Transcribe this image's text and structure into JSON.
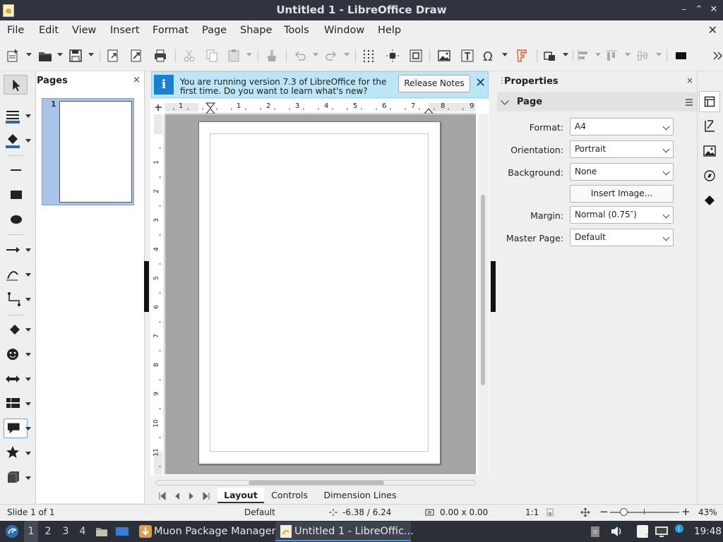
{
  "window": {
    "title": "Untitled 1 - LibreOffice Draw",
    "minimize_glyph": "–",
    "maximize_glyph": "⌃",
    "restore_glyph": "✕"
  },
  "menubar": {
    "items": [
      "File",
      "Edit",
      "View",
      "Insert",
      "Format",
      "Page",
      "Shape",
      "Tools",
      "Window",
      "Help"
    ],
    "close_glyph": "✕"
  },
  "toolbar": {
    "icons": [
      "new-icon",
      "open-icon",
      "save-icon",
      "export-icon",
      "export-pdf-icon",
      "print-icon",
      "cut-icon",
      "copy-icon",
      "paste-icon",
      "clone-formatting-icon",
      "undo-icon",
      "redo-icon",
      "grid-icon",
      "helplines-icon",
      "zoom-pan-icon",
      "image-icon",
      "textbox-icon",
      "special-character-icon",
      "fontwork-icon",
      "transformations-icon",
      "align-icon",
      "arrange-icon",
      "distribute-icon",
      "shadow-icon",
      "more-icon"
    ]
  },
  "left_toolbar": {
    "icons": [
      "select-icon",
      "line-color-icon",
      "fill-color-icon",
      "line-icon",
      "rectangle-icon",
      "ellipse-icon",
      "arrow-line-icon",
      "curve-icon",
      "connector-icon",
      "basic-shapes-icon",
      "symbol-shapes-icon",
      "block-arrows-icon",
      "flowchart-icon",
      "callouts-icon",
      "stars-icon",
      "3d-objects-icon"
    ]
  },
  "pages_panel": {
    "title": "Pages",
    "close_glyph": "×",
    "thumbnail_number": "1"
  },
  "infobar": {
    "message": "You are running version 7.3 of LibreOffice for the first time. Do you want to learn what's new?",
    "button": "Release Notes",
    "close_glyph": "✕",
    "icon_glyph": "i"
  },
  "ruler": {
    "h_labels": [
      "1",
      "1",
      "1",
      "2",
      "3",
      "4",
      "5",
      "6",
      "7",
      "8",
      "9"
    ],
    "v_labels": [
      "1",
      "1",
      "2",
      "3",
      "4",
      "5",
      "6",
      "7",
      "8",
      "9",
      "10",
      "11"
    ]
  },
  "tabs": {
    "items": [
      "Layout",
      "Controls",
      "Dimension Lines"
    ],
    "active": "Layout"
  },
  "properties": {
    "title": "Properties",
    "close_glyph": "×",
    "section": "Page",
    "fields": [
      {
        "label": "Format:",
        "value": "A4"
      },
      {
        "label": "Orientation:",
        "value": "Portrait"
      },
      {
        "label": "Background:",
        "value": "None"
      },
      {
        "label": "Margin:",
        "value": "Normal (0.75″)"
      },
      {
        "label": "Master Page:",
        "value": "Default"
      }
    ],
    "insert_image_button": "Insert Image..."
  },
  "deck": {
    "icons": [
      "properties-deck-icon",
      "styles-deck-icon",
      "gallery-deck-icon",
      "navigator-deck-icon",
      "shapes-deck-icon"
    ]
  },
  "statusbar": {
    "slide": "Slide 1 of 1",
    "master": "Default",
    "position": "-6.38 / 6.24",
    "size": "0.00 x 0.00",
    "scale": "1:1",
    "zoom": "43%",
    "zoom_minus": "−",
    "zoom_plus": "+"
  },
  "taskbar": {
    "workspaces": [
      "1",
      "2",
      "3",
      "4"
    ],
    "tasks": [
      "Muon Package Manager",
      "Untitled 1 - LibreOffic..."
    ],
    "clock": "19:48"
  },
  "colors": {
    "titlebar": "#2f343f",
    "taskbar": "#2b2f38",
    "infobar": "#bde5f8",
    "thumb_selected": "#a9c4e6",
    "canvas": "#a5a5a5"
  }
}
